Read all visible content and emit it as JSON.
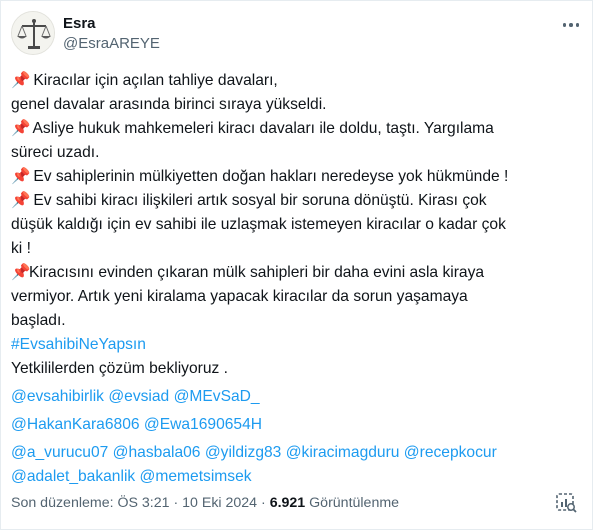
{
  "author": {
    "display_name": "Esra",
    "handle": "@EsraAREYE",
    "avatar_icon": "scales-of-justice-icon"
  },
  "more_icon": "more-options-icon",
  "tweet": {
    "lines": [
      {
        "pin": "📌",
        "text": " Kiracılar için açılan  tahliye davaları,"
      },
      {
        "pin": "",
        "text": "genel davalar arasında  birinci sıraya yükseldi."
      },
      {
        "pin": "📌",
        "text": " Asliye hukuk mahkemeleri kiracı davaları ile doldu, taştı. Yargılama"
      },
      {
        "pin": "",
        "text": "süreci uzadı."
      },
      {
        "pin": "📌",
        "text": " Ev sahiplerinin mülkiyetten doğan hakları neredeyse yok hükmünde !"
      },
      {
        "pin": "📌",
        "text": "  Ev sahibi kiracı ilişkileri artık sosyal bir soruna dönüştü. Kirası çok"
      },
      {
        "pin": "",
        "text": "düşük kaldığı için ev sahibi ile uzlaşmak istemeyen kiracılar o kadar çok"
      },
      {
        "pin": "",
        "text": "ki !"
      },
      {
        "pin": "📌",
        "text": "Kiracısını evinden çıkaran mülk sahipleri bir daha evini asla kiraya"
      },
      {
        "pin": "",
        "text": "vermiyor. Artık yeni kiralama yapacak kiracılar da sorun yaşamaya"
      },
      {
        "pin": "",
        "text": "başladı."
      }
    ],
    "hashtag": "#EvsahibiNeYapsın",
    "closing": "Yetkililerden çözüm bekliyoruz .",
    "mentions": [
      [
        "@evsahibirlik",
        "@evsiad",
        "@MEvSaD_"
      ],
      [
        "@HakanKara6806",
        "@Ewa1690654H"
      ],
      [
        "@a_vurucu07",
        "@hasbala06",
        "@yildizg83",
        "@kiracimagduru",
        "@recepkocur"
      ],
      [
        "@adalet_bakanlik",
        "@memetsimsek"
      ]
    ]
  },
  "meta": {
    "edited_text": "Son düzenleme: ÖS 3:21 · 10 Eki 2024 · ",
    "views_count": "6.921",
    "views_label": " Görüntülenme"
  },
  "stats_icon": "view-analytics-icon",
  "colors": {
    "link": "#1d9bf0",
    "text": "#0f1419",
    "secondary": "#536471"
  }
}
